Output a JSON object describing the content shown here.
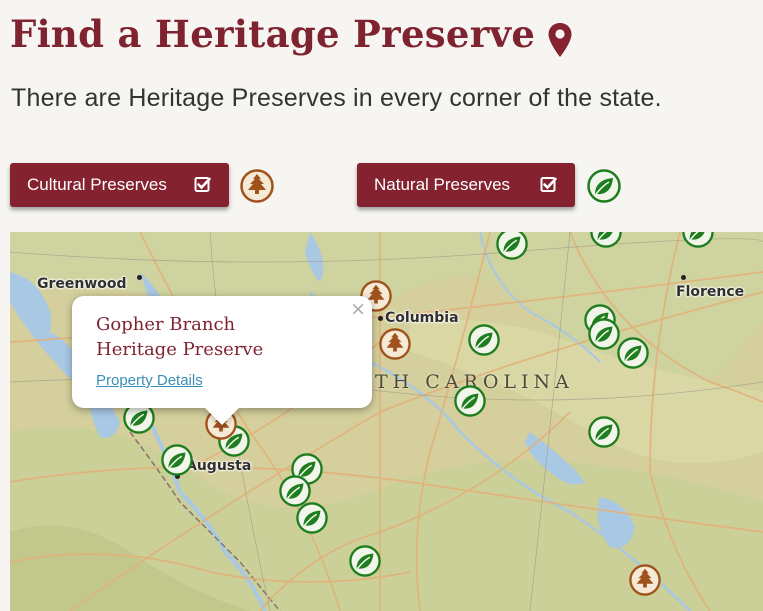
{
  "page": {
    "title": "Find a Heritage Preserve",
    "subtitle": "There are Heritage Preserves in every corner of the state."
  },
  "filters": {
    "cultural_label": "Cultural Preserves",
    "natural_label": "Natural Preserves"
  },
  "map": {
    "cities": {
      "greenwood": "Greenwood",
      "columbia": "Columbia",
      "florence": "Florence",
      "augusta": "Augusta"
    },
    "state_label": "TH CAROLINA",
    "popup": {
      "title": "Gopher Branch Heritage Preserve",
      "link": "Property Details",
      "close": "×"
    }
  },
  "colors": {
    "brand": "#84232f",
    "natural_marker": "#1e7d1e",
    "cultural_marker": "#a0521d"
  },
  "icons": {
    "title_icon": "map-pin-icon",
    "check": "checkbox-checked-icon",
    "cultural": "pine-tree-icon",
    "natural": "leaf-icon",
    "close": "close-icon"
  }
}
